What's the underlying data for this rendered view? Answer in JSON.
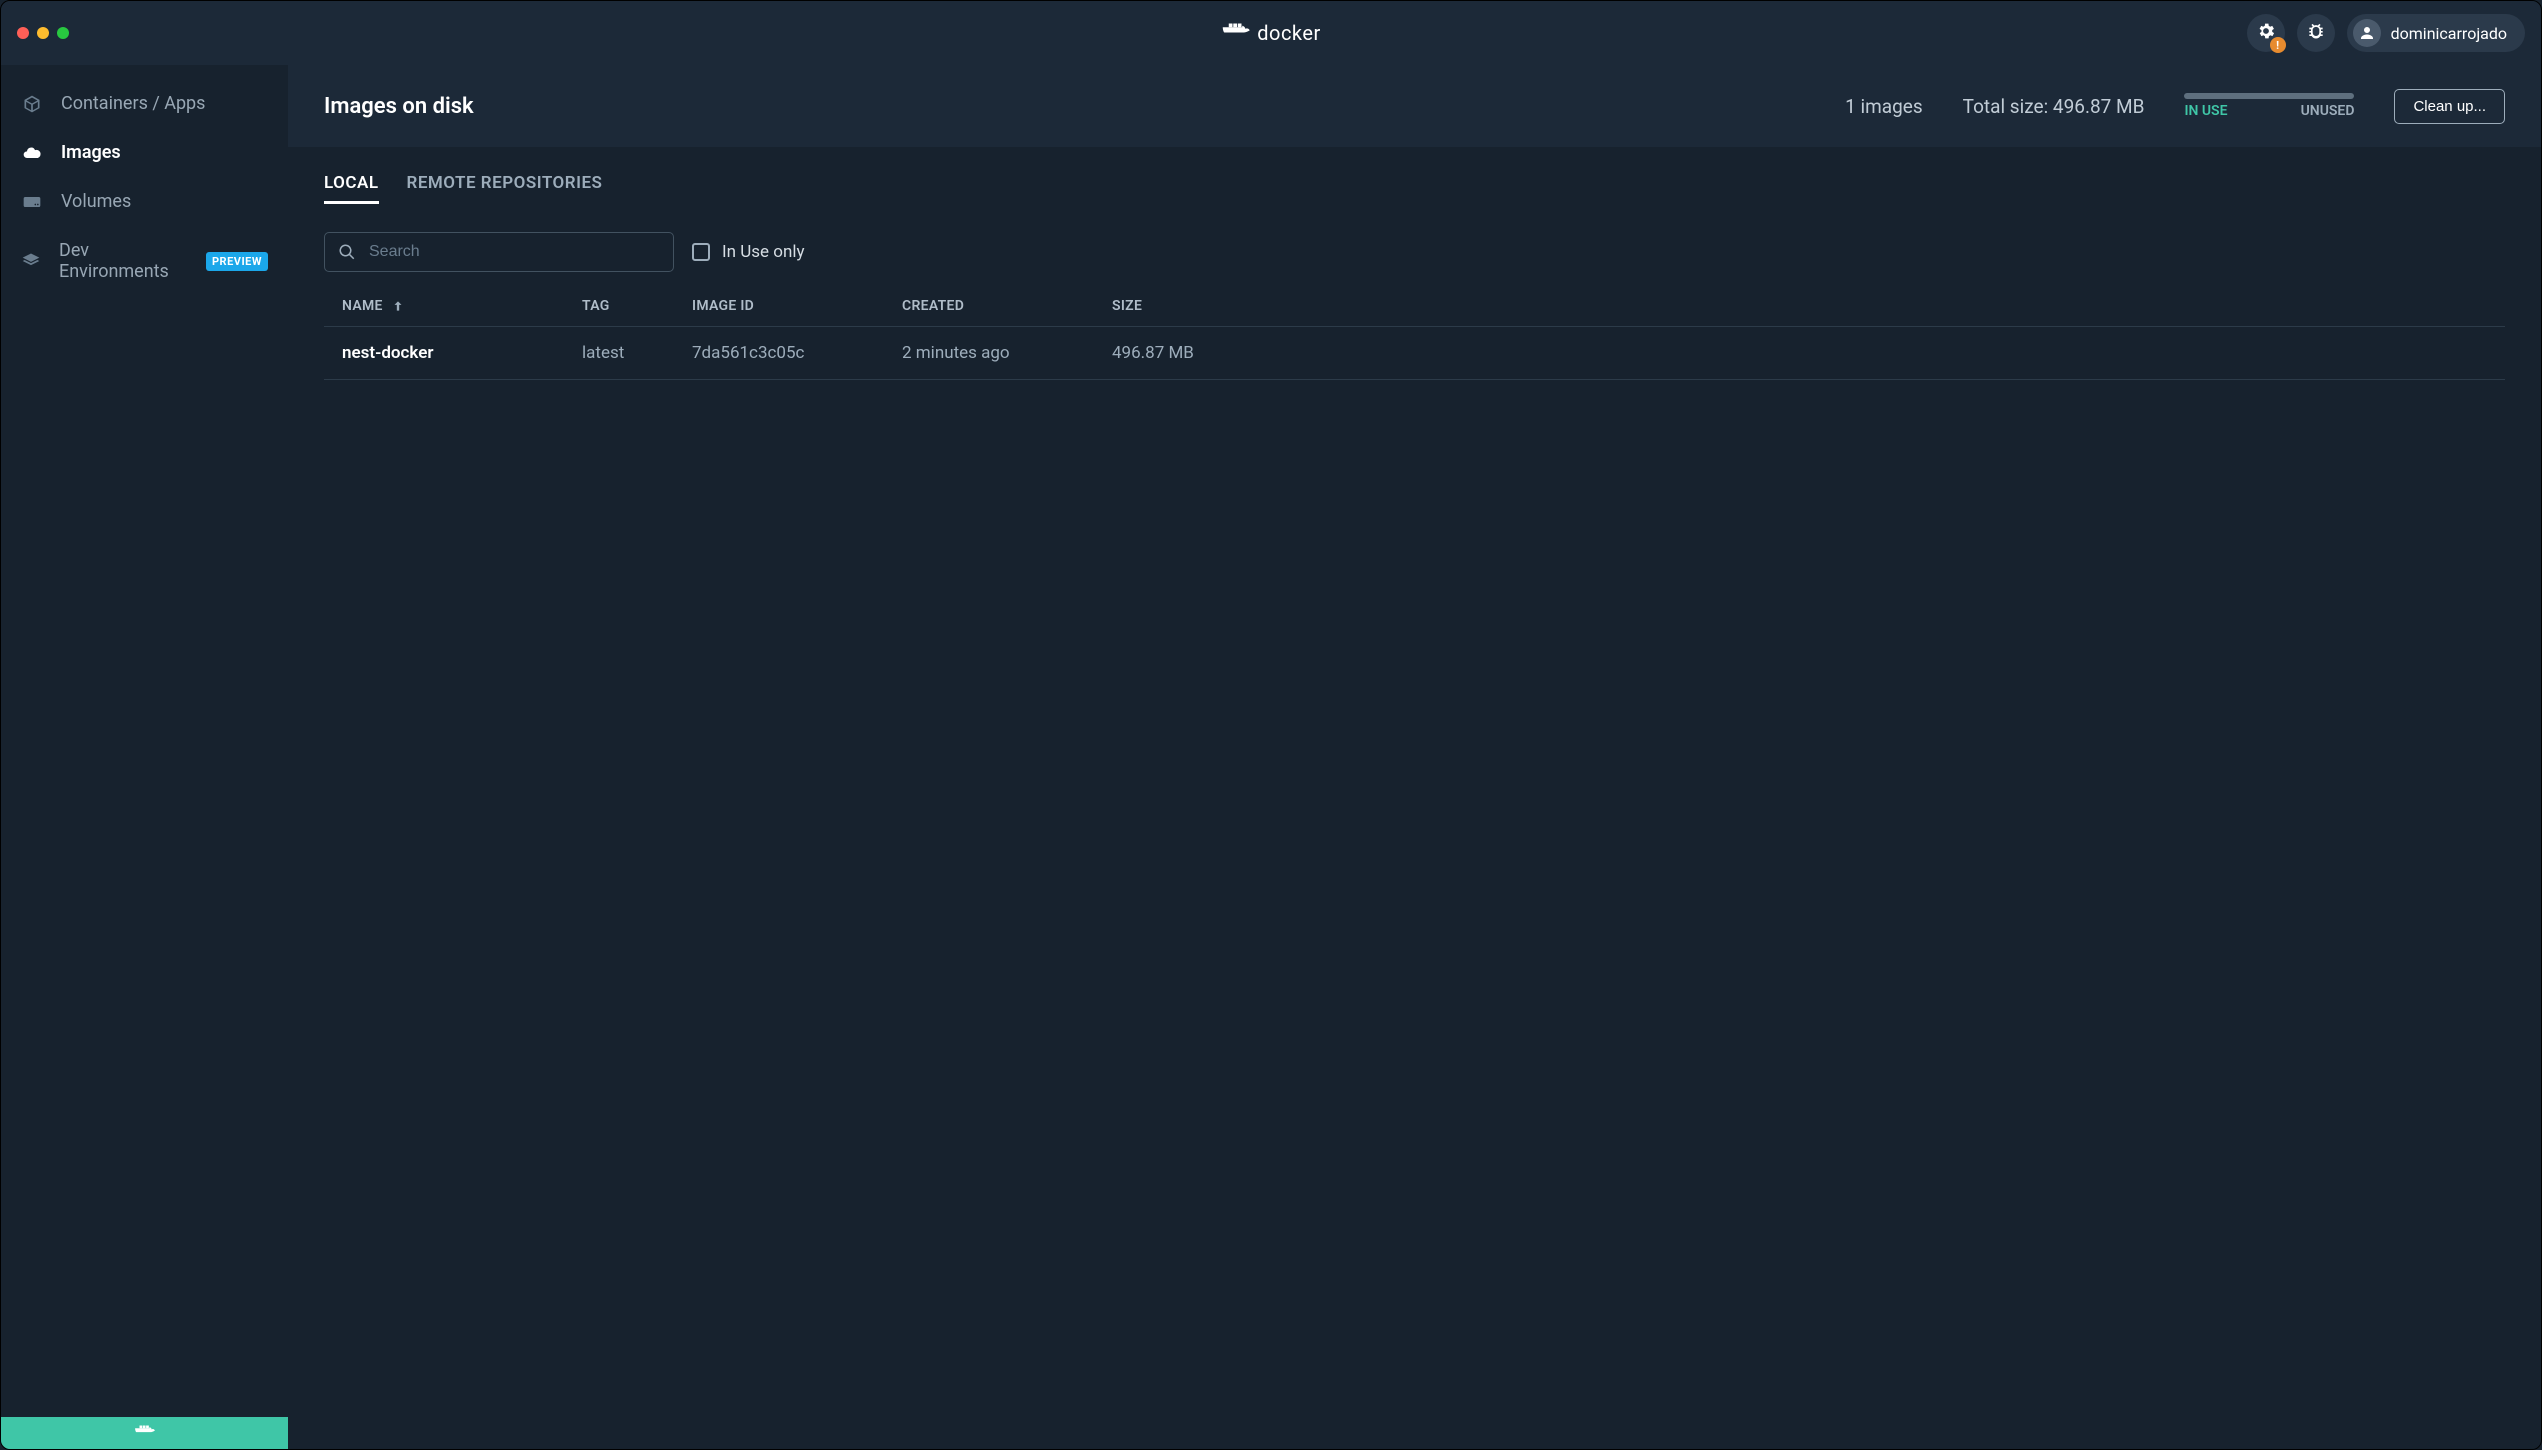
{
  "app": {
    "name": "docker"
  },
  "titlebar": {
    "settings_badge": "!",
    "account_name": "dominicarrojado"
  },
  "sidebar": {
    "items": [
      {
        "label": "Containers / Apps",
        "icon": "cube-icon",
        "active": false
      },
      {
        "label": "Images",
        "icon": "cloud-icon",
        "active": true
      },
      {
        "label": "Volumes",
        "icon": "drive-icon",
        "active": false
      },
      {
        "label": "Dev Environments",
        "icon": "layers-icon",
        "active": false,
        "badge": "PREVIEW"
      }
    ]
  },
  "header": {
    "title": "Images on disk",
    "count_text": "1 images",
    "total_size_text": "Total size: 496.87 MB",
    "usage": {
      "in_use_label": "IN USE",
      "unused_label": "UNUSED",
      "in_use_pct": 0
    },
    "clean_up_label": "Clean up..."
  },
  "tabs": [
    {
      "label": "LOCAL",
      "active": true
    },
    {
      "label": "REMOTE REPOSITORIES",
      "active": false
    }
  ],
  "filters": {
    "search_placeholder": "Search",
    "in_use_only_label": "In Use only",
    "in_use_only_checked": false
  },
  "table": {
    "columns": {
      "name": "NAME",
      "tag": "TAG",
      "image_id": "IMAGE ID",
      "created": "CREATED",
      "size": "SIZE"
    },
    "sort": {
      "column": "name",
      "direction": "asc"
    },
    "rows": [
      {
        "name": "nest-docker",
        "tag": "latest",
        "image_id": "7da561c3c05c",
        "created": "2 minutes ago",
        "size": "496.87 MB"
      }
    ]
  }
}
